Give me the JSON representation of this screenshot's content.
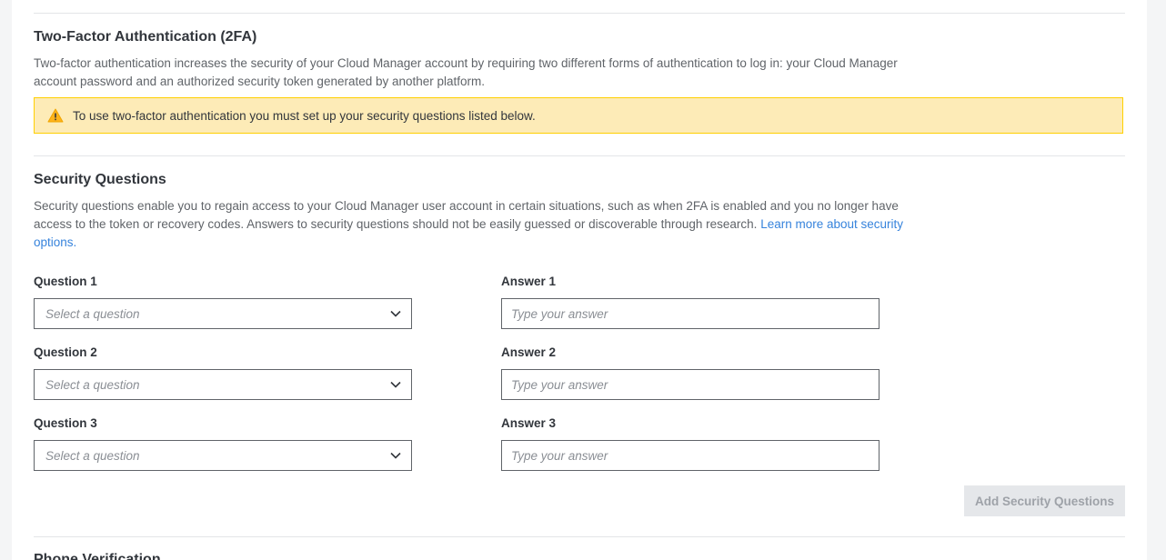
{
  "twofa": {
    "title": "Two-Factor Authentication (2FA)",
    "description": "Two-factor authentication increases the security of your Cloud Manager account by requiring two different forms of authentication to log in: your Cloud Manager account password and an authorized security token generated by another platform.",
    "notice": "To use two-factor authentication you must set up your security questions listed below.",
    "notice_icon": "warning-icon"
  },
  "security_questions": {
    "title": "Security Questions",
    "description": "Security questions enable you to regain access to your Cloud Manager user account in certain situations, such as when 2FA is enabled and you no longer have access to the token or recovery codes. Answers to security questions should not be easily guessed or discoverable through research.",
    "learn_more_link": "Learn more about security options.",
    "questions": [
      {
        "label": "Question 1",
        "select_placeholder": "Select a question",
        "answer_label": "Answer 1",
        "answer_placeholder": "Type your answer",
        "answer_value": ""
      },
      {
        "label": "Question 2",
        "select_placeholder": "Select a question",
        "answer_label": "Answer 2",
        "answer_placeholder": "Type your answer",
        "answer_value": ""
      },
      {
        "label": "Question 3",
        "select_placeholder": "Select a question",
        "answer_label": "Answer 3",
        "answer_placeholder": "Type your answer",
        "answer_value": ""
      }
    ],
    "submit_label": "Add Security Questions"
  },
  "phone_verification": {
    "title": "Phone Verification"
  },
  "colors": {
    "link": "#3683dc",
    "notice_bg": "#fdebb7",
    "notice_border": "#ffd002",
    "disabled_button_bg": "#e5e7ea",
    "disabled_button_text": "#9ea2a8"
  }
}
